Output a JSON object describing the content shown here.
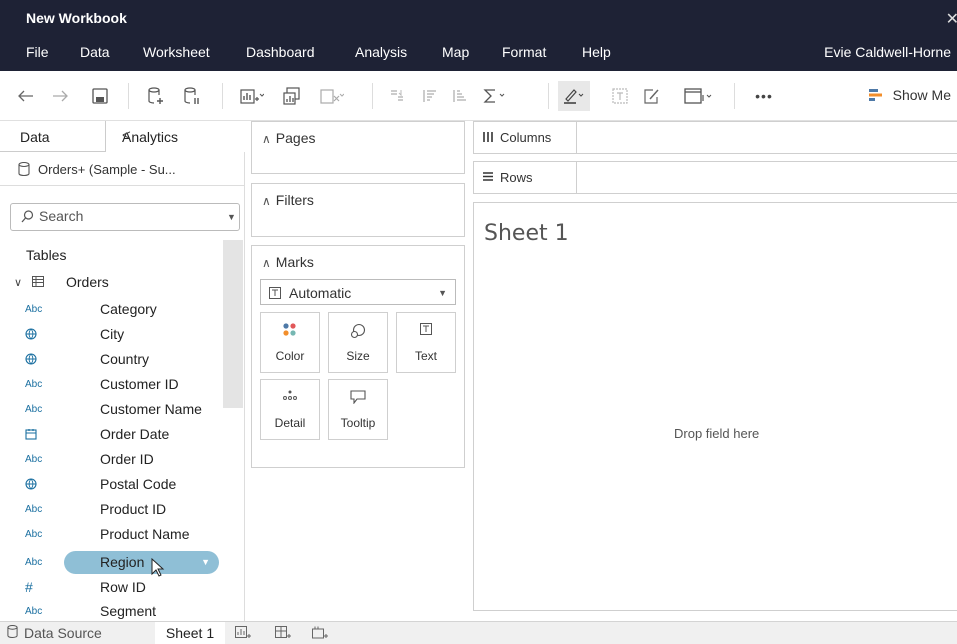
{
  "window": {
    "title": "New Workbook",
    "close": "✕"
  },
  "menu": {
    "items": [
      "File",
      "Data",
      "Worksheet",
      "Dashboard",
      "Analysis",
      "Map",
      "Format",
      "Help"
    ],
    "user": "Evie Caldwell-Horne"
  },
  "toolbar": {
    "show_me": "Show Me",
    "more": "•••"
  },
  "data_pane": {
    "tab_data": "Data",
    "tab_analytics": "Analytics",
    "collapse": "<",
    "datasource": "Orders+ (Sample - Su...",
    "search_placeholder": "Search",
    "tables_header": "Tables",
    "table_name": "Orders",
    "fields": [
      {
        "type": "Abc",
        "icon": "string-icon",
        "name": "Category"
      },
      {
        "type": "globe",
        "icon": "globe-icon",
        "name": "City"
      },
      {
        "type": "globe",
        "icon": "globe-icon",
        "name": "Country"
      },
      {
        "type": "Abc",
        "icon": "string-icon",
        "name": "Customer ID"
      },
      {
        "type": "Abc",
        "icon": "string-icon",
        "name": "Customer Name"
      },
      {
        "type": "date",
        "icon": "calendar-icon",
        "name": "Order Date"
      },
      {
        "type": "Abc",
        "icon": "string-icon",
        "name": "Order ID"
      },
      {
        "type": "globe",
        "icon": "globe-icon",
        "name": "Postal Code"
      },
      {
        "type": "Abc",
        "icon": "string-icon",
        "name": "Product ID"
      },
      {
        "type": "Abc",
        "icon": "string-icon",
        "name": "Product Name"
      },
      {
        "type": "Abc",
        "icon": "string-icon",
        "name": "Region"
      },
      {
        "type": "#",
        "icon": "number-icon",
        "name": "Row ID"
      },
      {
        "type": "Abc",
        "icon": "string-icon",
        "name": "Segment"
      }
    ],
    "selected_field": "Region",
    "abc_label": "Abc",
    "hash_label": "#"
  },
  "shelves": {
    "pages": "Pages",
    "filters": "Filters",
    "marks": "Marks",
    "mark_type": "Automatic",
    "mark_buttons": [
      "Color",
      "Size",
      "Text",
      "Detail",
      "Tooltip"
    ],
    "columns": "Columns",
    "rows": "Rows"
  },
  "view": {
    "sheet_title": "Sheet 1",
    "drop_hint": "Drop field here"
  },
  "bottom": {
    "data_source": "Data Source",
    "sheet": "Sheet 1"
  },
  "colors": {
    "chrome": "#1e2235",
    "pill": "#8fbfd6",
    "field_icon": "#1a6fa0"
  }
}
